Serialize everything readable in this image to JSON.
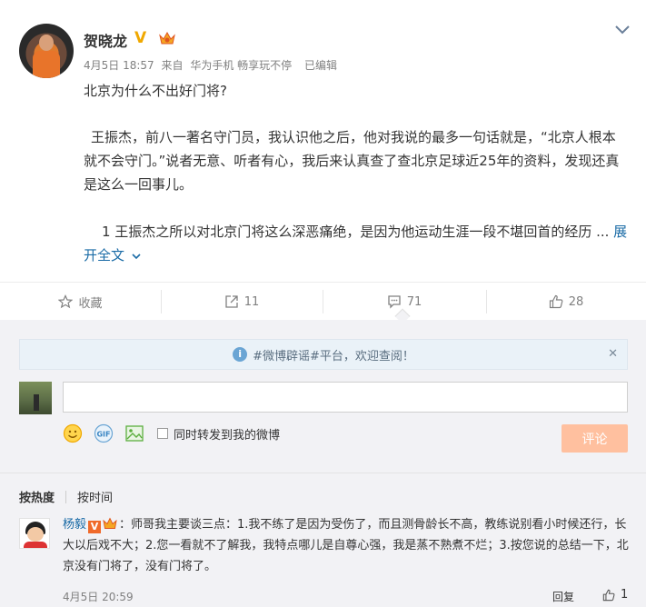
{
  "post": {
    "author": "贺晓龙",
    "date": "4月5日 18:57",
    "source_prefix": "来自",
    "source": "华为手机 畅享玩不停",
    "edited": "已编辑",
    "title": "北京为什么不出好门将?",
    "paragraph1": "王振杰，前八一著名守门员，我认识他之后，他对我说的最多一句话就是，“北京人根本就不会守门。”说者无意、听者有心，我后来认真查了查北京足球近25年的资料，发现还真是这么一回事儿。",
    "paragraph2": "1 王振杰之所以对北京门将这么深恶痛绝，是因为他运动生涯一段不堪回首的经历 ...",
    "expand_label": "展开全文"
  },
  "actions": {
    "favorite": "收藏",
    "forward_count": "11",
    "comment_count": "71",
    "like_count": "28"
  },
  "notice": "#微博辟谣#平台，欢迎查阅！",
  "composer": {
    "input_value": "",
    "repost_checkbox_label": "同时转发到我的微博",
    "submit_label": "评论"
  },
  "sort": {
    "hot": "按热度",
    "time": "按时间"
  },
  "comment": {
    "user": "杨毅",
    "text": "：师哥我主要谈三点：1.我不练了是因为受伤了，而且测骨龄长不高，教练说别看小时候还行，长大以后戏不大；2.您一看就不了解我，我特点哪儿是自尊心强，我是蒸不熟煮不烂；3.按您说的总结一下，北京没有门将了，没有门将了。",
    "date": "4月5日 20:59",
    "reply_label": "回复",
    "like_count": "1"
  },
  "colors": {
    "link": "#1a6ba6",
    "submit_disabled": "#ffc09f",
    "verified": "#f0a800"
  }
}
